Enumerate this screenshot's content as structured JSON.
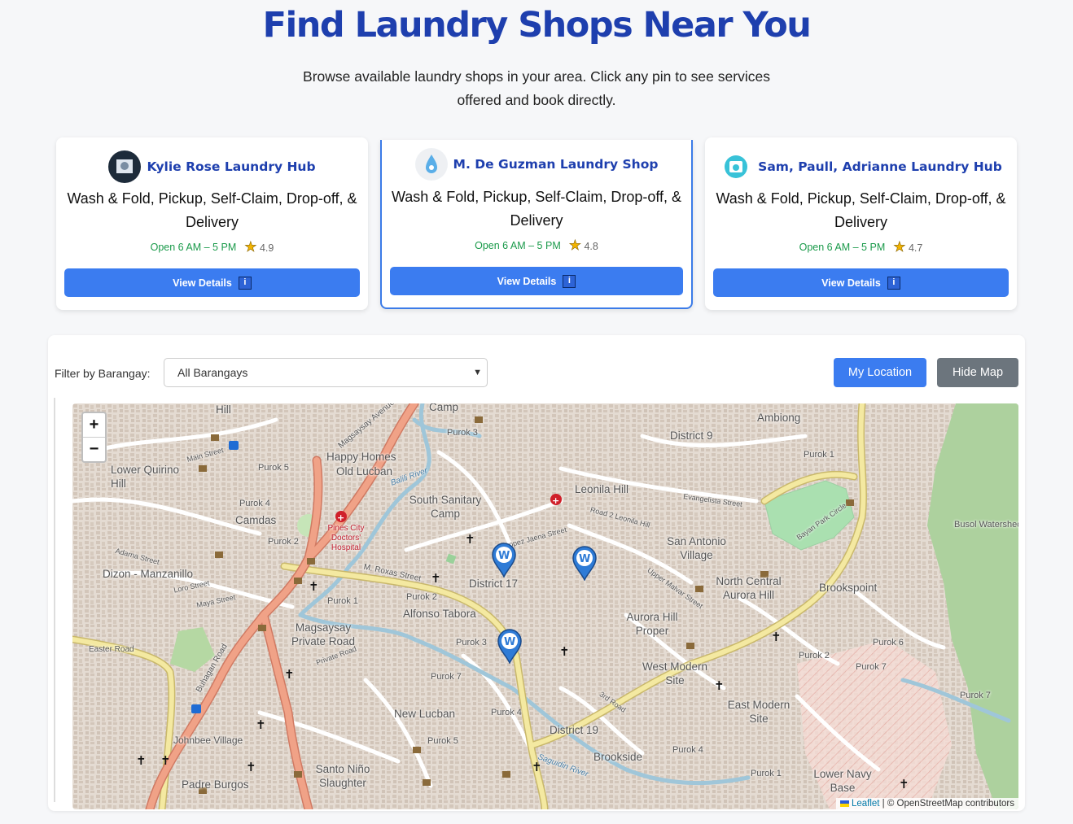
{
  "header": {
    "title": "Find Laundry Shops Near You",
    "subtitle": "Browse available laundry shops in your area. Click any pin to see services offered and book directly."
  },
  "shops": [
    {
      "name": "Kylie Rose Laundry Hub",
      "services": "Wash & Fold, Pickup, Self-Claim, Drop-off, & Delivery",
      "hours": "Open 6 AM – 5 PM",
      "rating": "4.9",
      "button": "View Details",
      "info_glyph": "i"
    },
    {
      "name": "M. De Guzman Laundry Shop",
      "services": "Wash & Fold, Pickup, Self-Claim, Drop-off, & Delivery",
      "hours": "Open 6 AM – 5 PM",
      "rating": "4.8",
      "button": "View Details",
      "info_glyph": "i"
    },
    {
      "name": "Sam, Paull, Adrianne Laundry Hub",
      "services": "Wash & Fold, Pickup, Self-Claim, Drop-off, & Delivery",
      "hours": "Open 6 AM – 5 PM",
      "rating": "4.7",
      "button": "View Details",
      "info_glyph": "i"
    }
  ],
  "controls": {
    "filter_label": "Filter by Barangay:",
    "filter_value": "All Barangays",
    "my_location": "My Location",
    "hide_map": "Hide Map"
  },
  "map": {
    "zoom_in": "+",
    "zoom_out": "−",
    "attribution_leaflet": "Leaflet",
    "attribution_rest": " | © OpenStreetMap contributors",
    "labels": [
      "Camp",
      "Purok 3",
      "District 9",
      "Ambiong",
      "Purok 1",
      "Hill",
      "Happy Homes",
      "Old Lucban",
      "Lower Quirino Hill",
      "Purok 5",
      "Leonila Hill",
      "South Sanitary Camp",
      "Camdas",
      "Purok 4",
      "Pines City Doctors' Hospital",
      "Purok 2",
      "San Antonio Village",
      "Dizon - Manzanillo",
      "District 17",
      "North Central Aurora Hill",
      "Brookspoint",
      "Busol Watershed",
      "Alfonso Tabora",
      "Aurora Hill Proper",
      "Magsaysay Private Road",
      "Purok 1",
      "Purok 2",
      "Purok 3",
      "West Modern Site",
      "Purok 6",
      "Purok 7",
      "East Modern Site",
      "New Lucban",
      "Purok 4",
      "District 19",
      "Purok 5",
      "Johnbee Village",
      "Brookside",
      "Santo Niño Slaughter",
      "Padre Burgos",
      "Lower Navy Base",
      "Purok 7",
      "Purok 4",
      "Purok 2",
      "Purok 7",
      "Purok 1"
    ],
    "street_labels": [
      "Magsaysay Avenue",
      "Main Street",
      "M. Roxas Street",
      "Lopez Jaena Street",
      "Upper Malvar Street",
      "Evangelista Street",
      "Bayan Park Circle",
      "Easter Road",
      "Buhagan Road",
      "Road 2 Leonila Hill",
      "Balili River",
      "Saguidin River",
      "3rd Road",
      "Private Road",
      "Adarna Street",
      "Maya Street",
      "Loro Street"
    ]
  }
}
